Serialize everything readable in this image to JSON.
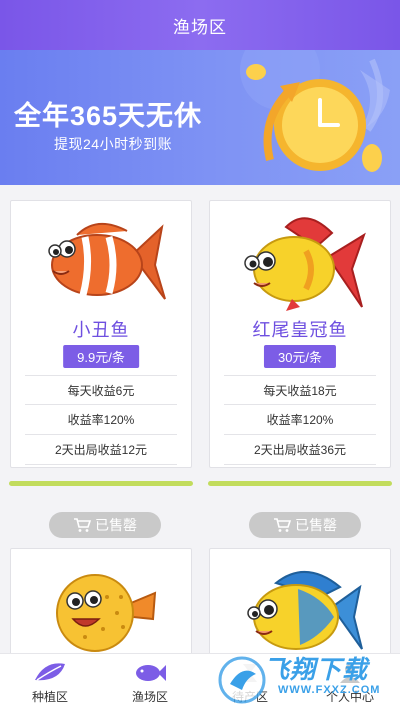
{
  "header": {
    "title": "渔场区"
  },
  "banner": {
    "headline": "全年365天无休",
    "subline": "提现24小时秒到账",
    "icon": "clock-coin-icon"
  },
  "products": [
    {
      "name": "小丑鱼",
      "price": "9.9元/条",
      "daily_income": "每天收益6元",
      "yield_rate": "收益率120%",
      "exit_income": "2天出局收益12元",
      "progress": 1.0,
      "status": "已售罄",
      "icon": "clownfish-icon"
    },
    {
      "name": "红尾皇冠鱼",
      "price": "30元/条",
      "daily_income": "每天收益18元",
      "yield_rate": "收益率120%",
      "exit_income": "2天出局收益36元",
      "progress": 1.0,
      "status": "已售罄",
      "icon": "red-tail-crown-fish-icon"
    },
    {
      "icon": "pufferfish-icon"
    },
    {
      "icon": "blue-yellow-fish-icon"
    }
  ],
  "tabbar": {
    "items": [
      {
        "label": "种植区",
        "icon": "leaf-icon"
      },
      {
        "label": "渔场区",
        "icon": "fish-icon"
      },
      {
        "label": "待产区",
        "icon": "hourglass-icon"
      },
      {
        "label": "个人中心",
        "icon": "person-icon"
      }
    ]
  },
  "watermark": {
    "text": "飞翔下载",
    "url": "WWW.FXXZ.COM"
  },
  "colors": {
    "accent": "#7c5de6",
    "progress": "#c2dc5d",
    "sold_out": "#c9c9c9",
    "header": "#7a56e8"
  }
}
